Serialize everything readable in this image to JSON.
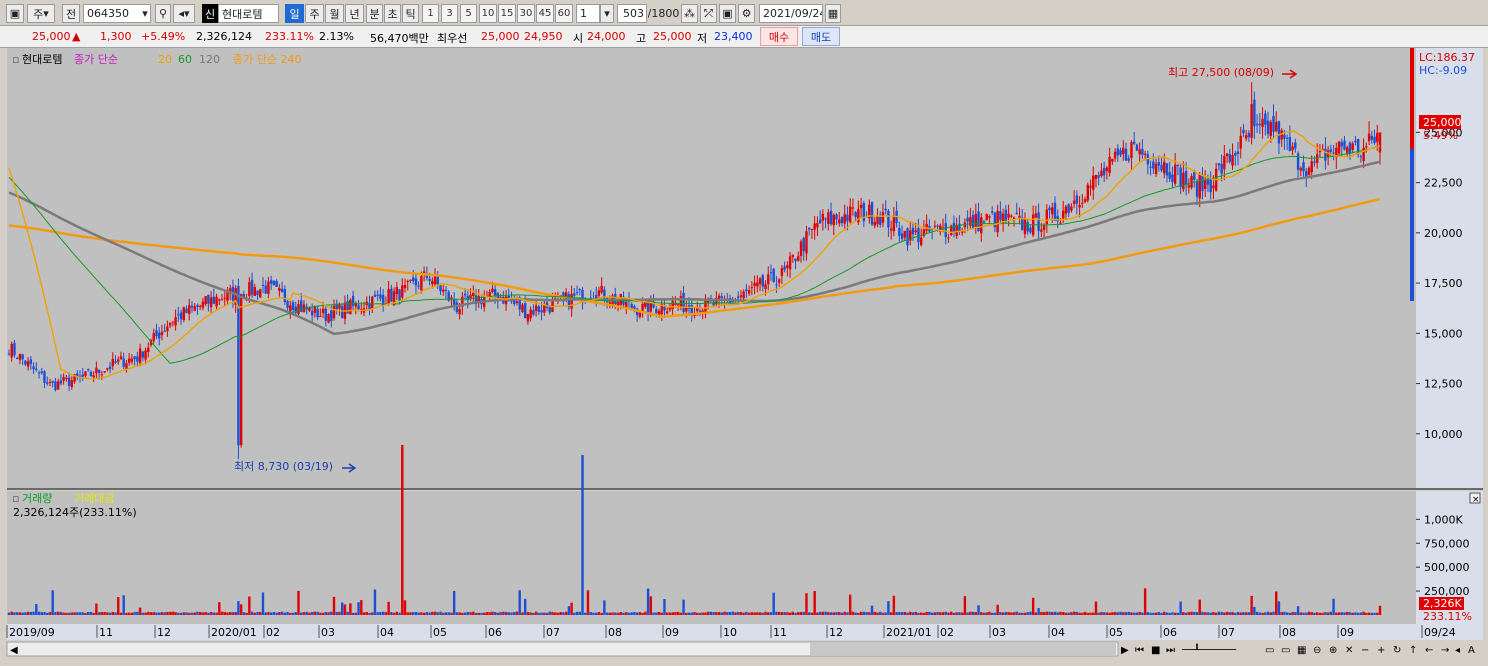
{
  "toolbar": {
    "period_type": "주",
    "prev_label": "전",
    "code": "064350",
    "new_label": "신",
    "name": "현대로템",
    "periods": [
      "일",
      "주",
      "월",
      "년"
    ],
    "active_period": "일",
    "intervals": [
      "분",
      "초",
      "틱"
    ],
    "numbers": [
      "1",
      "3",
      "5",
      "10",
      "15",
      "30",
      "45",
      "60"
    ],
    "unit": "1",
    "count": "503",
    "max_count": "/1800",
    "date": "2021/09/24"
  },
  "quote": {
    "price": "25,000",
    "arrow": "▲",
    "change": "1,300",
    "change_pct": "+5.49%",
    "volume": "2,326,124",
    "volume_ratio": "233.11%",
    "turnover": "2.13%",
    "amount": "56,470백만",
    "best_label": "최우선",
    "best_ask": "25,000",
    "best_bid": "24,950",
    "open_label": "시",
    "open": "24,000",
    "high_label": "고",
    "high": "25,000",
    "low_label": "저",
    "low": "23,400",
    "buy_label": "매수",
    "sell_label": "매도"
  },
  "price_panel": {
    "legend_name": "현대로템",
    "legend_ma": "종가 단순",
    "legend_p1": "20",
    "legend_p2": "60",
    "legend_p3": "120",
    "legend_ma2": "종가 단순 240",
    "lc": "LC:186.37",
    "hc": "HC:-9.09",
    "current": "25,000",
    "current_pct": "5.49%",
    "high_note": "최고 27,500 (08/09)",
    "low_note": "최저 8,730 (03/19)"
  },
  "volume_panel": {
    "legend_vol": "거래량",
    "legend_amt": "거래대금",
    "info": "2,326,124주(233.11%)",
    "current": "2,326K",
    "current_pct": "233.11%"
  },
  "colors": {
    "up": "#e00000",
    "down": "#1a4fd6",
    "ma20": "#f0a000",
    "ma60": "#139a2a",
    "ma120": "#7a7a7a",
    "ma240": "#f39a12",
    "bg": "#c0c0c0"
  },
  "chart_data": {
    "type": "candlestick",
    "yticks": [
      10000,
      12500,
      15000,
      17500,
      20000,
      22500,
      25000
    ],
    "ylim": [
      7500,
      29000
    ],
    "vol_ticks": [
      250000,
      500000,
      750000,
      1000000
    ],
    "vol_tick_labels": [
      "250,000",
      "500,000",
      "750,000",
      "1,000K"
    ],
    "x_labels": [
      "2019/09",
      "11",
      "12",
      "2020/01",
      "02",
      "03",
      "04",
      "05",
      "06",
      "07",
      "08",
      "09",
      "10",
      "11",
      "12",
      "2021/01",
      "02",
      "03",
      "04",
      "05",
      "06",
      "07",
      "08",
      "09",
      "09/24"
    ],
    "bars": 503,
    "high": 27500,
    "low": 8730,
    "last": 25000,
    "waypoints": [
      [
        0,
        19500
      ],
      [
        8,
        20500
      ],
      [
        15,
        20800
      ],
      [
        30,
        19400
      ],
      [
        40,
        18500
      ],
      [
        60,
        17000
      ],
      [
        75,
        16500
      ],
      [
        90,
        15700
      ],
      [
        105,
        15100
      ],
      [
        115,
        15300
      ],
      [
        125,
        15900
      ],
      [
        140,
        15400
      ],
      [
        155,
        14900
      ],
      [
        166,
        16300
      ],
      [
        175,
        17400
      ],
      [
        190,
        15700
      ],
      [
        205,
        15300
      ],
      [
        215,
        15700
      ],
      [
        230,
        14300
      ],
      [
        248,
        12400
      ],
      [
        262,
        12800
      ],
      [
        278,
        13600
      ],
      [
        285,
        13800
      ],
      [
        300,
        15700
      ],
      [
        320,
        16800
      ],
      [
        340,
        17300
      ],
      [
        355,
        16300
      ],
      [
        365,
        15900
      ],
      [
        380,
        16400
      ],
      [
        400,
        17100
      ],
      [
        410,
        17900
      ],
      [
        422,
        16300
      ],
      [
        430,
        16700
      ],
      [
        440,
        16900
      ],
      [
        452,
        16100
      ],
      [
        460,
        16300
      ],
      [
        470,
        16700
      ],
      [
        482,
        17100
      ],
      [
        497,
        16300
      ],
      [
        503,
        16200
      ],
      [
        515,
        16500
      ],
      [
        525,
        16300
      ],
      [
        540,
        16600
      ],
      [
        552,
        17300
      ],
      [
        563,
        18000
      ],
      [
        568,
        19000
      ],
      [
        577,
        20500
      ],
      [
        587,
        20800
      ],
      [
        595,
        21000
      ],
      [
        604,
        20900
      ],
      [
        616,
        19800
      ],
      [
        628,
        20100
      ],
      [
        640,
        20400
      ],
      [
        652,
        20700
      ],
      [
        668,
        20400
      ],
      [
        680,
        20900
      ],
      [
        696,
        22600
      ],
      [
        712,
        24300
      ],
      [
        728,
        23200
      ],
      [
        738,
        22300
      ],
      [
        745,
        22500
      ],
      [
        756,
        24100
      ],
      [
        762,
        24800
      ],
      [
        772,
        25300
      ],
      [
        780,
        24000
      ],
      [
        788,
        23100
      ],
      [
        795,
        24000
      ],
      [
        802,
        24300
      ],
      [
        811,
        24100
      ],
      [
        818,
        25000
      ]
    ],
    "start_index": 230,
    "end_index": 818,
    "low_index": 328,
    "high_index": 763,
    "pre_drop": 15000,
    "pre_drop_index": 300,
    "rebound": 17800,
    "rebound_index": 372
  }
}
